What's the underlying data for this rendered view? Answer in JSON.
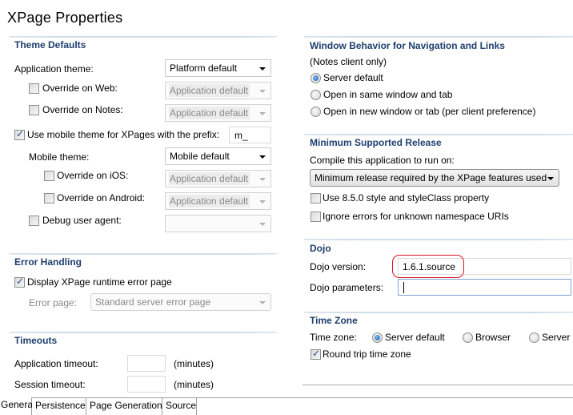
{
  "page": {
    "title": "XPage Properties"
  },
  "theme_defaults": {
    "title": "Theme Defaults",
    "application_theme_label": "Application theme:",
    "application_theme_value": "Platform default",
    "override_web_label": "Override on Web:",
    "override_web_checked": false,
    "override_web_value": "Application default",
    "override_notes_label": "Override on Notes:",
    "override_notes_checked": false,
    "override_notes_value": "Application default",
    "use_mobile_label": "Use mobile theme for XPages with the prefix:",
    "use_mobile_checked": true,
    "mobile_prefix_value": "m_",
    "mobile_theme_label": "Mobile theme:",
    "mobile_theme_value": "Mobile default",
    "override_ios_label": "Override on iOS:",
    "override_ios_checked": false,
    "override_ios_value": "Application default",
    "override_android_label": "Override on Android:",
    "override_android_checked": false,
    "override_android_value": "Application default",
    "debug_agent_label": "Debug user agent:",
    "debug_agent_checked": false,
    "debug_agent_value": ""
  },
  "error_handling": {
    "title": "Error Handling",
    "display_error_label": "Display XPage runtime error page",
    "display_error_checked": true,
    "error_page_label": "Error page:",
    "error_page_value": "Standard server error page"
  },
  "timeouts": {
    "title": "Timeouts",
    "app_timeout_label": "Application timeout:",
    "app_timeout_value": "",
    "app_timeout_unit": "(minutes)",
    "session_timeout_label": "Session timeout:",
    "session_timeout_value": "",
    "session_timeout_unit": "(minutes)"
  },
  "window_behavior": {
    "title": "Window Behavior for Navigation and Links",
    "subtitle": "(Notes client only)",
    "options": [
      {
        "label": "Server default",
        "selected": true
      },
      {
        "label": "Open in same window and tab",
        "selected": false
      },
      {
        "label": "Open in new window or tab (per client preference)",
        "selected": false
      }
    ]
  },
  "min_release": {
    "title": "Minimum Supported Release",
    "compile_label": "Compile this application to run on:",
    "compile_value": "Minimum release required by the XPage features used",
    "use_850_label": "Use 8.5.0 style and styleClass property",
    "use_850_checked": false,
    "ignore_errors_label": "Ignore errors for unknown namespace URIs",
    "ignore_errors_checked": false
  },
  "dojo": {
    "title": "Dojo",
    "version_label": "Dojo version:",
    "version_value": "1.6.1.source",
    "params_label": "Dojo parameters:",
    "params_value": ""
  },
  "time_zone": {
    "title": "Time Zone",
    "label": "Time zone:",
    "options": [
      {
        "label": "Server default",
        "selected": true
      },
      {
        "label": "Browser",
        "selected": false
      },
      {
        "label": "Server",
        "selected": false
      }
    ],
    "round_trip_label": "Round trip time zone",
    "round_trip_checked": true
  },
  "tabs": [
    {
      "label": "General",
      "active": true
    },
    {
      "label": "Persistence",
      "active": false
    },
    {
      "label": "Page Generation",
      "active": false
    },
    {
      "label": "Source",
      "active": false
    }
  ],
  "colors": {
    "section_title": "#1f3f6e",
    "highlight": "#e0121c",
    "radio_selected": "#1a5fb4"
  }
}
